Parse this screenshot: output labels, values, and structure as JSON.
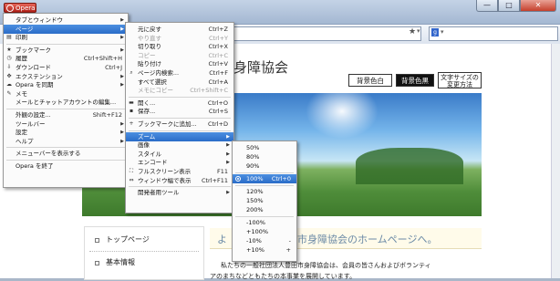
{
  "browser": {
    "menu_button": "Opera",
    "window_controls": {
      "minimize": "—",
      "maximize": "□",
      "close": "✕"
    },
    "search_engine_badge": "g"
  },
  "main_menu": {
    "items": [
      {
        "label": "タブとウィンドウ",
        "submenu": true,
        "icon": ""
      },
      {
        "label": "ページ",
        "submenu": true,
        "highlight": true,
        "icon": ""
      },
      {
        "label": "印刷",
        "submenu": true,
        "icon": "printer-icon"
      },
      {
        "sep": true
      },
      {
        "label": "ブックマーク",
        "submenu": true,
        "icon": "star-icon"
      },
      {
        "label": "履歴",
        "shortcut": "Ctrl+Shift+H",
        "icon": "history-icon"
      },
      {
        "label": "ダウンロード",
        "shortcut": "Ctrl+J",
        "icon": "download-icon"
      },
      {
        "label": "エクステンション",
        "submenu": true,
        "icon": "extension-icon"
      },
      {
        "label": "Opera を同期",
        "submenu": true,
        "icon": "sync-icon"
      },
      {
        "label": "メモ",
        "icon": "note-icon"
      },
      {
        "label": "メールとチャットアカウントの編集...",
        "icon": ""
      },
      {
        "sep": true
      },
      {
        "label": "外観の設定...",
        "shortcut": "Shift+F12",
        "icon": ""
      },
      {
        "label": "ツールバー",
        "submenu": true,
        "icon": ""
      },
      {
        "label": "設定",
        "submenu": true,
        "icon": ""
      },
      {
        "label": "ヘルプ",
        "submenu": true,
        "icon": ""
      },
      {
        "sep": true
      },
      {
        "label": "メニューバーを表示する",
        "icon": ""
      },
      {
        "sep": true
      },
      {
        "label": "Opera を終了",
        "icon": ""
      }
    ]
  },
  "page_menu": {
    "items": [
      {
        "label": "元に戻す",
        "shortcut": "Ctrl+Z"
      },
      {
        "label": "やり直す",
        "shortcut": "Ctrl+Y",
        "disabled": true
      },
      {
        "label": "切り取り",
        "shortcut": "Ctrl+X"
      },
      {
        "label": "コピー",
        "shortcut": "Ctrl+C",
        "disabled": true
      },
      {
        "label": "貼り付け",
        "shortcut": "Ctrl+V"
      },
      {
        "label": "ページ内検索...",
        "shortcut": "Ctrl+F",
        "icon": "search-icon"
      },
      {
        "label": "すべて選択",
        "shortcut": "Ctrl+A"
      },
      {
        "label": "メモにコピー",
        "shortcut": "Ctrl+Shift+C",
        "disabled": true
      },
      {
        "sep": true
      },
      {
        "label": "開く...",
        "shortcut": "Ctrl+O",
        "icon": "folder-icon"
      },
      {
        "label": "保存...",
        "shortcut": "Ctrl+S",
        "icon": "save-icon"
      },
      {
        "sep": true
      },
      {
        "label": "ブックマークに追加...",
        "shortcut": "Ctrl+D",
        "icon": "add-icon"
      },
      {
        "sep": true
      },
      {
        "label": "ズーム",
        "submenu": true,
        "highlight": true
      },
      {
        "label": "画像",
        "submenu": true
      },
      {
        "label": "スタイル",
        "submenu": true
      },
      {
        "label": "エンコード",
        "submenu": true
      },
      {
        "label": "フルスクリーン表示",
        "shortcut": "F11",
        "icon": "fullscreen-icon"
      },
      {
        "label": "ウィンドウ幅で表示",
        "shortcut": "Ctrl+F11",
        "icon": "fit-width-icon"
      },
      {
        "sep": true
      },
      {
        "label": "開発者用ツール",
        "submenu": true
      }
    ]
  },
  "zoom_menu": {
    "items": [
      {
        "label": "50%"
      },
      {
        "label": "80%"
      },
      {
        "label": "90%"
      },
      {
        "sep": true
      },
      {
        "label": "100%",
        "shortcut": "Ctrl+0",
        "highlight": true,
        "selected": true
      },
      {
        "sep": true
      },
      {
        "label": "120%"
      },
      {
        "label": "150%"
      },
      {
        "label": "200%"
      },
      {
        "sep": true
      },
      {
        "label": "-100%"
      },
      {
        "label": "+100%"
      },
      {
        "label": "-10%",
        "shortcut": "-"
      },
      {
        "label": "+10%",
        "shortcut": "+"
      }
    ]
  },
  "site": {
    "title_fragment": "身障協会",
    "style_buttons": [
      "背景色白",
      "背景色黒"
    ],
    "font_size_button": [
      "文字サイズの",
      "変更方法"
    ],
    "nav": [
      "基本情報",
      "トップページ"
    ],
    "welcome_heading": "よ　　　　　　　市身障協会のホームページへ。",
    "intro_line1": "私たちの一般社団法人豊田市身障協会は、会員の皆さんおよびボランティ",
    "intro_line2": "アのまちなどともたちの本事業を展開しています。"
  }
}
